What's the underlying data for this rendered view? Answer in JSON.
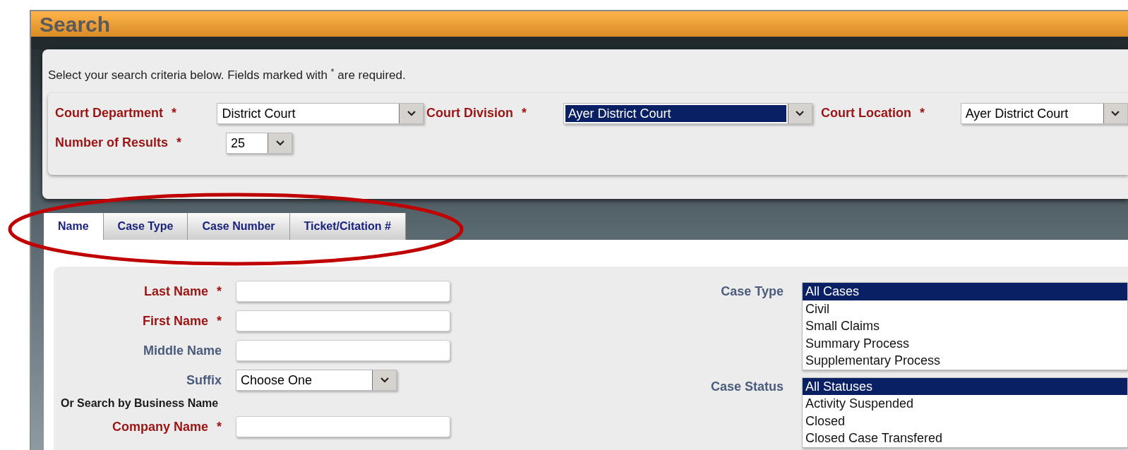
{
  "window": {
    "title": "Search"
  },
  "criteria": {
    "instructions": "Select your search criteria below. Fields marked with $^{*}$ are required.",
    "fields": [
      {
        "label": "Court Department",
        "required_mark": "*",
        "value": "District Court",
        "focused": false
      },
      {
        "label": "Court Division",
        "required_mark": "*",
        "value": "Ayer District Court",
        "focused": true
      },
      {
        "label": "Court Location",
        "required_mark": "*",
        "value": "Ayer District Court",
        "focused": false
      },
      {
        "label": "Number of Results",
        "required_mark": "*",
        "value": "25",
        "focused": false
      }
    ]
  },
  "tabs": [
    {
      "label": "Name",
      "selected": true
    },
    {
      "label": "Case Type",
      "selected": false
    },
    {
      "label": "Case Number",
      "selected": false
    },
    {
      "label": "Ticket/Citation #",
      "selected": false
    }
  ],
  "name_form": {
    "fields": [
      {
        "kind": "text",
        "label": "Last Name",
        "required_mark": "*"
      },
      {
        "kind": "text",
        "label": "First Name",
        "required_mark": "*"
      },
      {
        "kind": "text",
        "label": "Middle Name"
      },
      {
        "kind": "select",
        "label": "Suffix",
        "value": "Choose One"
      },
      {
        "kind": "heading",
        "label": "Or Search by Business Name"
      },
      {
        "kind": "text",
        "label": "Company Name",
        "required_mark": "*"
      }
    ],
    "lists": [
      {
        "label": "Case Type",
        "options": [
          {
            "text": "All Cases",
            "selected": true
          },
          {
            "text": "Civil",
            "selected": false
          },
          {
            "text": "Small Claims",
            "selected": false
          },
          {
            "text": "Summary Process",
            "selected": false
          },
          {
            "text": "Supplementary Process",
            "selected": false
          }
        ]
      },
      {
        "label": "Case Status",
        "options": [
          {
            "text": "All Statuses",
            "selected": true
          },
          {
            "text": "Activity Suspended",
            "selected": false
          },
          {
            "text": "Closed",
            "selected": false
          },
          {
            "text": "Closed Case Transfered",
            "selected": false
          }
        ]
      }
    ]
  },
  "annotation": {
    "kind": "ellipse"
  }
}
